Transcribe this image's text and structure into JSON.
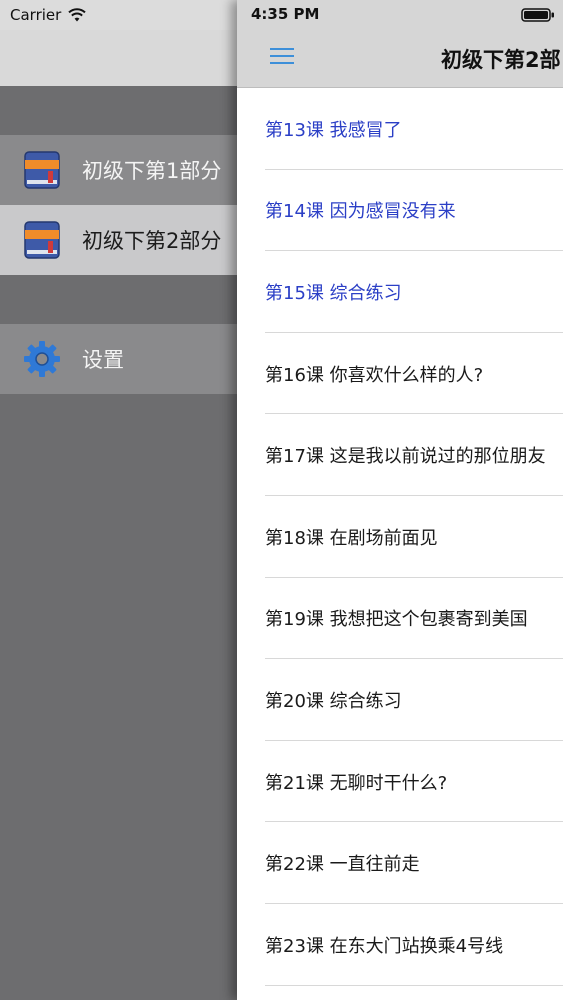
{
  "status_bar": {
    "carrier": "Carrier",
    "time": "4:35 PM"
  },
  "side_menu": {
    "items": [
      {
        "label": "初级下第1部分",
        "icon": "book-icon",
        "state": "normal"
      },
      {
        "label": "初级下第2部分",
        "icon": "book-icon",
        "state": "selected"
      }
    ],
    "settings": {
      "label": "设置",
      "icon": "gear-icon"
    }
  },
  "nav_bar": {
    "title": "初级下第2部",
    "menu_icon": "hamburger-icon"
  },
  "lessons": [
    {
      "text": "第13课 我感冒了",
      "read": true
    },
    {
      "text": "第14课 因为感冒没有来",
      "read": true
    },
    {
      "text": "第15课 综合练习",
      "read": true
    },
    {
      "text": "第16课 你喜欢什么样的人?",
      "read": false
    },
    {
      "text": "第17课 这是我以前说过的那位朋友",
      "read": false
    },
    {
      "text": "第18课 在剧场前面见",
      "read": false
    },
    {
      "text": "第19课 我想把这个包裹寄到美国",
      "read": false
    },
    {
      "text": "第20课 综合练习",
      "read": false
    },
    {
      "text": "第21课 无聊时干什么?",
      "read": false
    },
    {
      "text": "第22课 一直往前走",
      "read": false
    },
    {
      "text": "第23课 在东大门站换乘4号线",
      "read": false
    }
  ],
  "colors": {
    "accent": "#3d8fd9",
    "read_lesson": "#2b3fc6",
    "unread_lesson": "#1a1a1a",
    "menu_selected_bg": "#c9c9cb"
  }
}
